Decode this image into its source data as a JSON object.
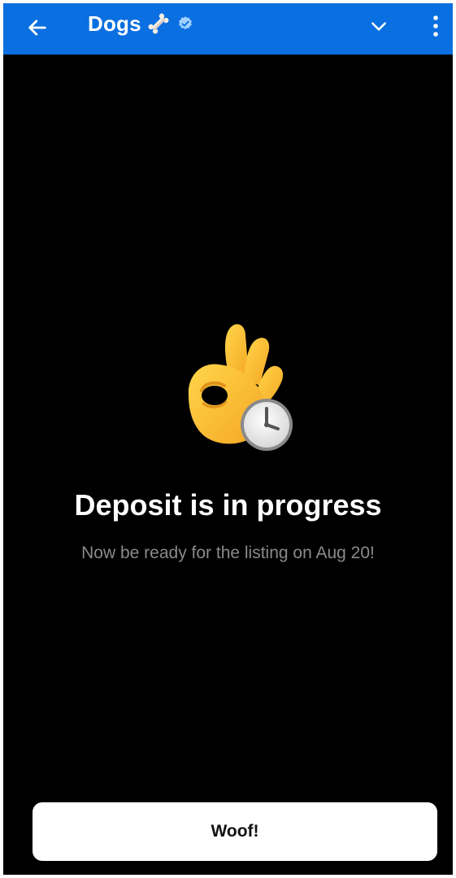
{
  "header": {
    "title": "Dogs",
    "title_emoji_icon": "bone-icon",
    "verified_icon": "verified-badge-icon",
    "back_icon": "arrow-left-icon",
    "expand_icon": "chevron-down-icon",
    "menu_icon": "more-vertical-icon",
    "background_color": "#0a6fe0"
  },
  "main": {
    "hero_icon": "ok-hand-with-clock-icon",
    "headline": "Deposit is in progress",
    "subtext": "Now be ready for the listing on Aug 20!"
  },
  "footer": {
    "button_label": "Woof!"
  }
}
